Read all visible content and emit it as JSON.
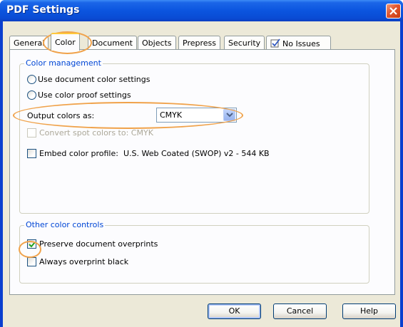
{
  "window": {
    "title": "PDF Settings"
  },
  "tabs": [
    {
      "label": "General"
    },
    {
      "label": "Color"
    },
    {
      "label": "Document"
    },
    {
      "label": "Objects"
    },
    {
      "label": "Prepress"
    },
    {
      "label": "Security"
    },
    {
      "label": "No Issues"
    }
  ],
  "active_tab": "Color",
  "color_management": {
    "title": "Color management",
    "radio_document": "Use document color settings",
    "radio_proof": "Use color proof settings",
    "output_label": "Output colors as:",
    "output_value": "CMYK",
    "convert_spot": "Convert spot colors to:  CMYK",
    "embed_label": "Embed color profile:",
    "embed_profile": "U.S. Web Coated (SWOP) v2 - 544 KB"
  },
  "other_controls": {
    "title": "Other color controls",
    "preserve_overprints": "Preserve document overprints",
    "preserve_checked": true,
    "always_overprint": "Always overprint black",
    "always_checked": false
  },
  "buttons": {
    "ok": "OK",
    "cancel": "Cancel",
    "help": "Help"
  },
  "colors": {
    "titlebar": "#0b55df",
    "dialog_bg": "#ece9d8",
    "group_title": "#0046d5",
    "highlight": "#f0a24a"
  }
}
